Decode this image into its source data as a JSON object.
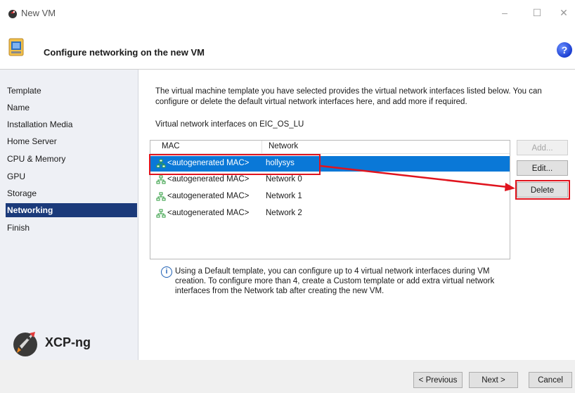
{
  "window": {
    "title": "New VM",
    "minimize": "–",
    "maximize": "☐",
    "close": "✕"
  },
  "header": {
    "title": "Configure networking on the new VM",
    "help": "?"
  },
  "sidebar": {
    "items": [
      {
        "label": "Template"
      },
      {
        "label": "Name"
      },
      {
        "label": "Installation Media"
      },
      {
        "label": "Home Server"
      },
      {
        "label": "CPU & Memory"
      },
      {
        "label": "GPU"
      },
      {
        "label": "Storage"
      },
      {
        "label": "Networking",
        "active": true
      },
      {
        "label": "Finish"
      }
    ],
    "logo_text": "XCP-ng"
  },
  "main": {
    "description": "The virtual machine template you have selected provides the virtual network interfaces listed below. You can configure or delete the default virtual network interfaces here, and add more if required.",
    "interfaces_label": "Virtual network interfaces on EIC_OS_LU",
    "table": {
      "columns": [
        "MAC",
        "Network"
      ],
      "rows": [
        {
          "mac": "<autogenerated MAC>",
          "network": "hollysys",
          "selected": true
        },
        {
          "mac": "<autogenerated MAC>",
          "network": "Network 0"
        },
        {
          "mac": "<autogenerated MAC>",
          "network": "Network 1"
        },
        {
          "mac": "<autogenerated MAC>",
          "network": "Network 2"
        }
      ]
    },
    "buttons": {
      "add": "Add...",
      "edit": "Edit...",
      "delete": "Delete"
    },
    "info_icon": "i",
    "info_text": "Using a Default template, you can configure up to 4 virtual network interfaces during VM creation. To configure more than 4, create a Custom template or add extra virtual network interfaces from the Network tab after creating the new VM."
  },
  "footer": {
    "previous": "< Previous",
    "next": "Next >",
    "cancel": "Cancel"
  },
  "colors": {
    "selection": "#0a78d7",
    "sidebar_active": "#1b3a7a",
    "annotation": "#e0141e"
  }
}
